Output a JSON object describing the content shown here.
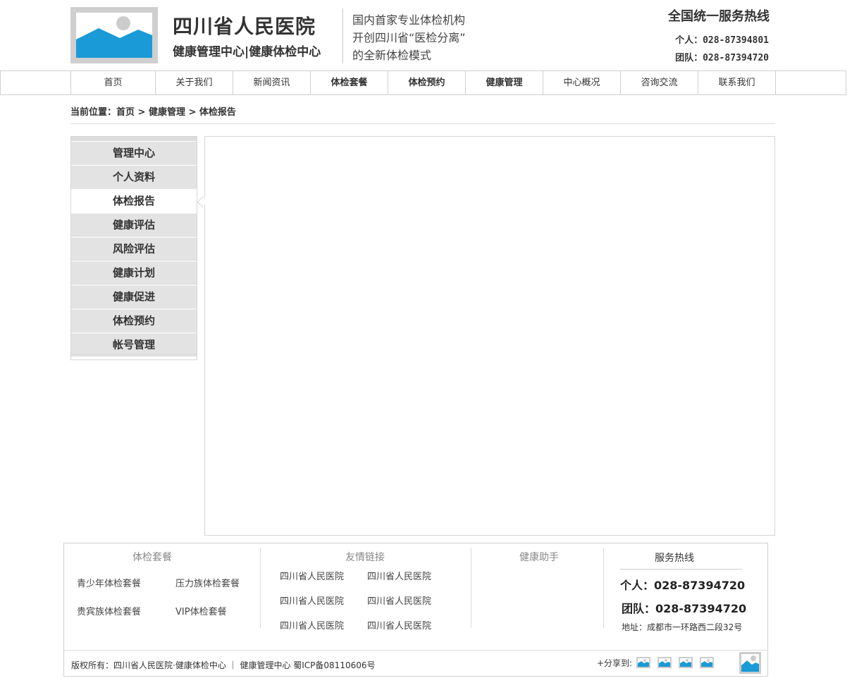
{
  "header": {
    "logo_icon": "image-placeholder-icon",
    "hospital_name": "四川省人民医院",
    "subtitle": "健康管理中心|健康体检中心",
    "slogan": [
      "国内首家专业体检机构",
      "开创四川省“医检分离”",
      "的全新体检模式"
    ],
    "hotline_title": "全国统一服务热线",
    "hotline_personal": "个人：028-87394801",
    "hotline_team": "团队：028-87394720"
  },
  "nav": {
    "items": [
      {
        "label": "首页",
        "bold": false
      },
      {
        "label": "关于我们",
        "bold": false
      },
      {
        "label": "新闻资讯",
        "bold": false
      },
      {
        "label": "体检套餐",
        "bold": true
      },
      {
        "label": "体检预约",
        "bold": true
      },
      {
        "label": "健康管理",
        "bold": true
      },
      {
        "label": "中心概况",
        "bold": false
      },
      {
        "label": "咨询交流",
        "bold": false
      },
      {
        "label": "联系我们",
        "bold": false
      }
    ]
  },
  "breadcrumb": "当前位置：首页 > 健康管理 > 体检报告",
  "sidebar": {
    "active": "体检报告",
    "items": [
      "管理中心",
      "个人资料",
      "体检报告",
      "健康评估",
      "风险评估",
      "健康计划",
      "健康促进",
      "体检预约",
      "帐号管理"
    ]
  },
  "footer": {
    "packages": {
      "heading": "体检套餐",
      "links": [
        "青少年体检套餐",
        "压力族体检套餐",
        "贵宾族体检套餐",
        "VIP体检套餐"
      ]
    },
    "friend_links": {
      "heading": "友情链接",
      "links": [
        "四川省人民医院",
        "四川省人民医院",
        "四川省人民医院",
        "四川省人民医院",
        "四川省人民医院",
        "四川省人民医院"
      ]
    },
    "assistant": {
      "heading": "健康助手"
    },
    "service": {
      "title": "服务热线",
      "personal": "个人：028-87394720",
      "team": "团队：028-87394720",
      "address": "地址：成都市一环路西二段32号"
    },
    "copyright": "版权所有：四川省人民医院·健康体检中心 ｜ 健康管理中心   蜀ICP备08110606号",
    "share_label": "+分享到:",
    "share_icons": [
      "share-icon-1",
      "share-icon-2",
      "share-icon-3",
      "share-icon-4"
    ]
  },
  "colors": {
    "logo_blue": "#1a9ad6",
    "placeholder_gray": "#cccccc",
    "sidebar_gray": "#e3e3e3"
  }
}
